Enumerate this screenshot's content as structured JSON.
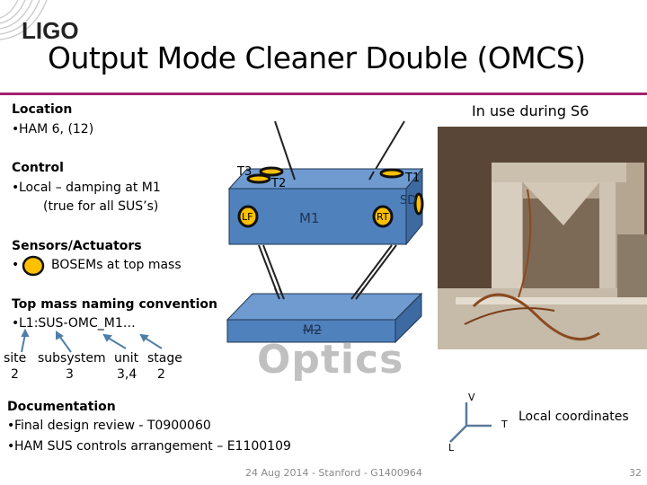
{
  "logo": {
    "text": "LIGO"
  },
  "title": "Output Mode Cleaner Double (OMCS)",
  "sections": {
    "location": {
      "heading": "Location",
      "items": [
        "HAM 6, (12)"
      ]
    },
    "control": {
      "heading": "Control",
      "items": [
        "Local – damping at M1"
      ],
      "note": "(true for all SUS’s)"
    },
    "sensors": {
      "heading": "Sensors/Actuators",
      "items": [
        "BOSEMs at top mass"
      ]
    },
    "naming": {
      "heading": "Top mass naming convention",
      "example": "L1:SUS-OMC_M1…",
      "labels": [
        "site",
        "subsystem",
        "unit",
        "stage"
      ],
      "counts": [
        "2",
        "3",
        "3,4",
        "2"
      ]
    },
    "documentation": {
      "heading": "Documentation",
      "items": [
        "Final design review - T0900060",
        "HAM SUS controls arrangement – E1100109"
      ]
    }
  },
  "diagram": {
    "top_mass": "M1",
    "bottom_mass": "M2",
    "osems": {
      "t1": "T1",
      "t2": "T2",
      "t3": "T3",
      "sd": "SD",
      "lf": "LF",
      "rt": "RT"
    },
    "watermark": "Optics",
    "colors": {
      "front": "#4f81bd",
      "top": "#6f9bd0",
      "side": "#3d6aa0",
      "osem": "#ffc000"
    }
  },
  "photo": {
    "caption": "In use during S6"
  },
  "coordinates": {
    "v": "V",
    "t": "T",
    "l": "L",
    "label": "Local coordinates"
  },
  "footer": {
    "text": "24 Aug 2014 - Stanford - G1400964",
    "page": "32"
  },
  "bullet": "•"
}
